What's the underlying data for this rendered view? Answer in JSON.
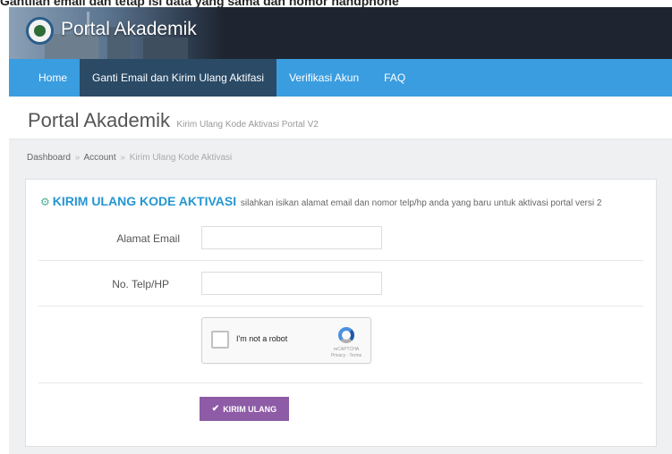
{
  "caption": "Gantilah email dan tetap isi data yang sama dan nomor handphone",
  "header": {
    "brand": "Portal Akademik"
  },
  "nav": {
    "items": [
      {
        "label": "Home"
      },
      {
        "label": "Ganti Email dan Kirim Ulang Aktifasi"
      },
      {
        "label": "Verifikasi Akun"
      },
      {
        "label": "FAQ"
      }
    ]
  },
  "page": {
    "title": "Portal Akademik",
    "subtitle": "Kirim Ulang Kode Aktivasi Portal V2"
  },
  "breadcrumb": {
    "items": [
      "Dashboard",
      "Account",
      "Kirim Ulang Kode Aktivasi"
    ],
    "separator": "»"
  },
  "panel": {
    "title": "KIRIM ULANG KODE AKTIVASI",
    "description": "silahkan isikan alamat email dan nomor telp/hp anda yang baru untuk aktivasi portal versi 2",
    "icon": "gears-icon"
  },
  "form": {
    "email_label": "Alamat Email",
    "email_value": "",
    "phone_label": "No. Telp/HP",
    "phone_value": "",
    "captcha_text": "I'm not a robot",
    "captcha_brand": "reCAPTCHA",
    "captcha_links": "Privacy - Terms",
    "submit_label": "KIRIM ULANG"
  },
  "colors": {
    "navbar": "#3a9de0",
    "nav_active": "#2a4a66",
    "panel_title": "#2596d0",
    "submit": "#8e5ba6"
  }
}
